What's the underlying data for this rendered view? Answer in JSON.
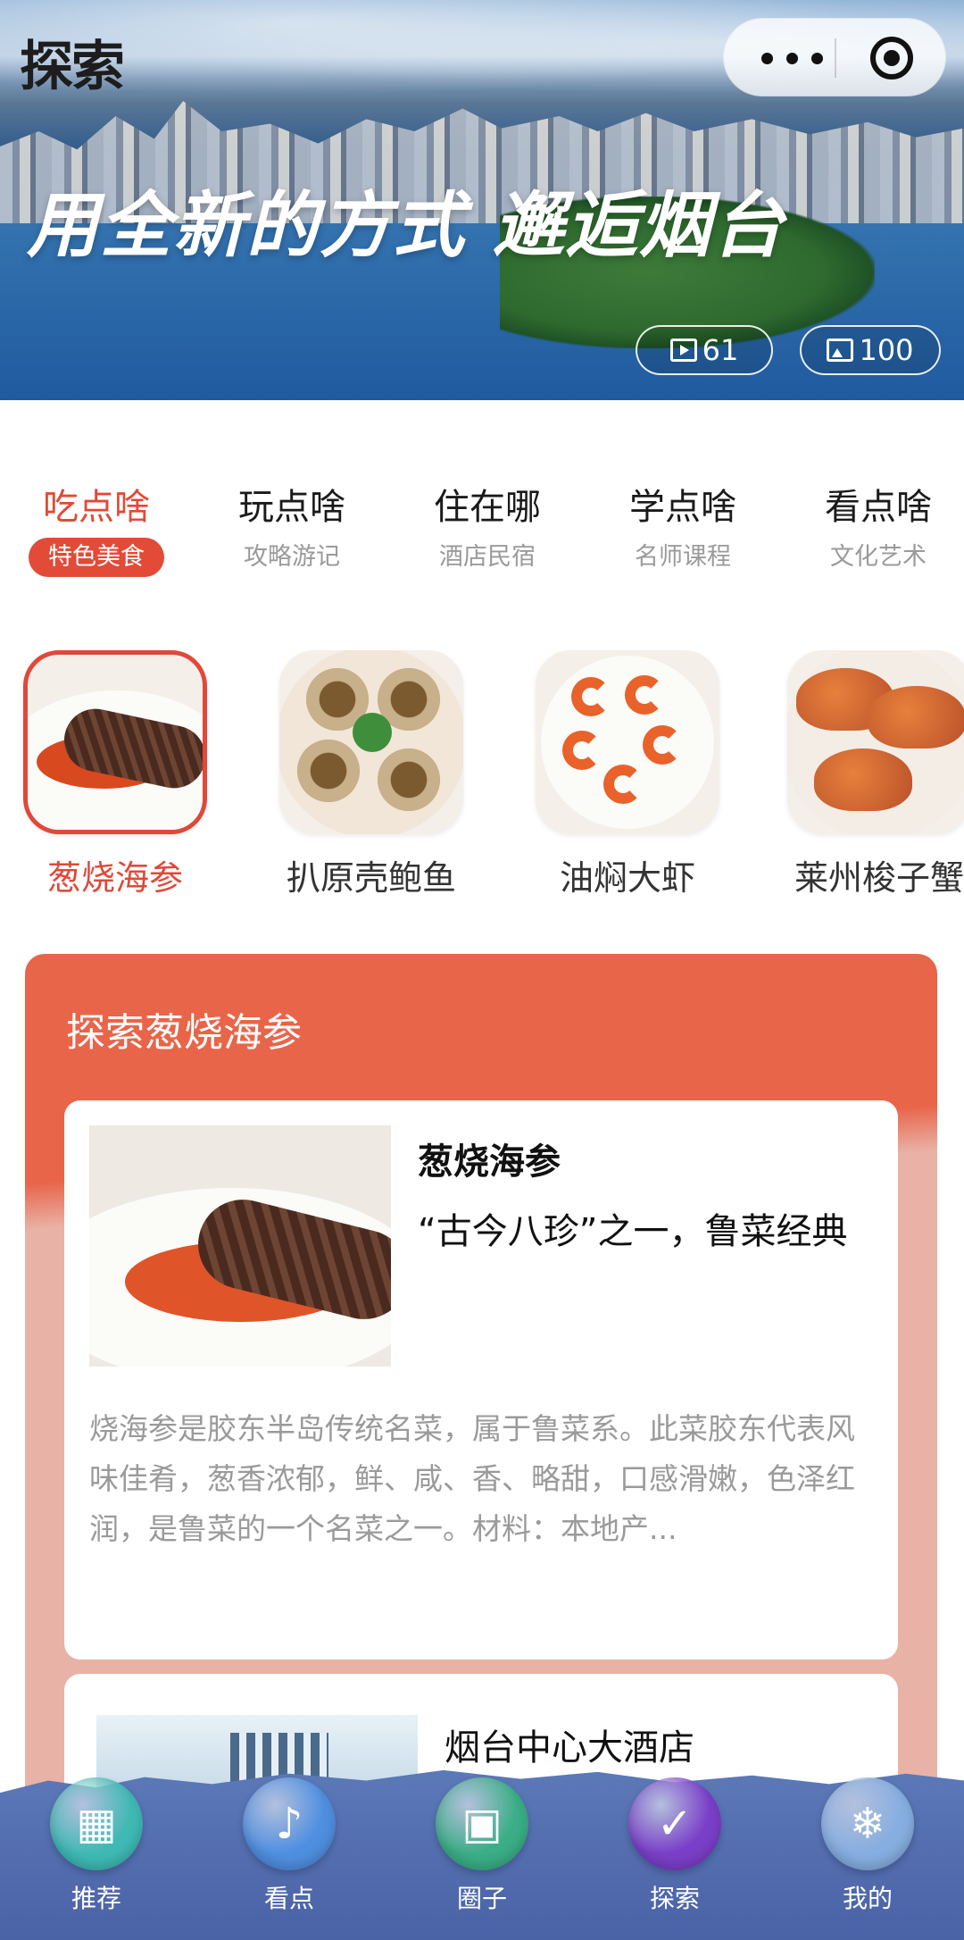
{
  "hero": {
    "logo": "探索",
    "slogan": "用全新的方式 邂逅烟台",
    "video_count": "61",
    "photo_count": "100"
  },
  "tabs": [
    {
      "title": "吃点啥",
      "sub": "特色美食",
      "active": true
    },
    {
      "title": "玩点啥",
      "sub": "攻略游记",
      "active": false
    },
    {
      "title": "住在哪",
      "sub": "酒店民宿",
      "active": false
    },
    {
      "title": "学点啥",
      "sub": "名师课程",
      "active": false
    },
    {
      "title": "看点啥",
      "sub": "文化艺术",
      "active": false
    }
  ],
  "dishes": [
    {
      "name": "葱烧海参",
      "active": true
    },
    {
      "name": "扒原壳鲍鱼",
      "active": false
    },
    {
      "name": "油焖大虾",
      "active": false
    },
    {
      "name": "莱州梭子蟹",
      "active": false
    }
  ],
  "explore": {
    "heading": "探索葱烧海参",
    "cards": [
      {
        "title": "葱烧海参",
        "subtitle": "“古今八珍”之一，鲁菜经典",
        "desc": "烧海参是胶东半岛传统名菜，属于鲁菜系。此菜胶东代表风味佳肴，葱香浓郁，鲜、咸、香、略甜，口感滑嫩，色泽红润，是鲁菜的一个名菜之一。材料：本地产..."
      },
      {
        "title": "烟台中心大酒店"
      }
    ]
  },
  "bottom_nav": [
    {
      "label": "推荐",
      "icon": "storefront-icon",
      "glyph": "▦",
      "color": "#3fb9b4"
    },
    {
      "label": "看点",
      "icon": "bells-icon",
      "glyph": "♪",
      "color": "#4f8fe0"
    },
    {
      "label": "圈子",
      "icon": "frame-icon",
      "glyph": "▣",
      "color": "#3aae86"
    },
    {
      "label": "探索",
      "icon": "sleigh-icon",
      "glyph": "✓",
      "color": "#7a3fc8"
    },
    {
      "label": "我的",
      "icon": "snowflake-icon",
      "glyph": "❄",
      "color": "#86aee0"
    }
  ]
}
